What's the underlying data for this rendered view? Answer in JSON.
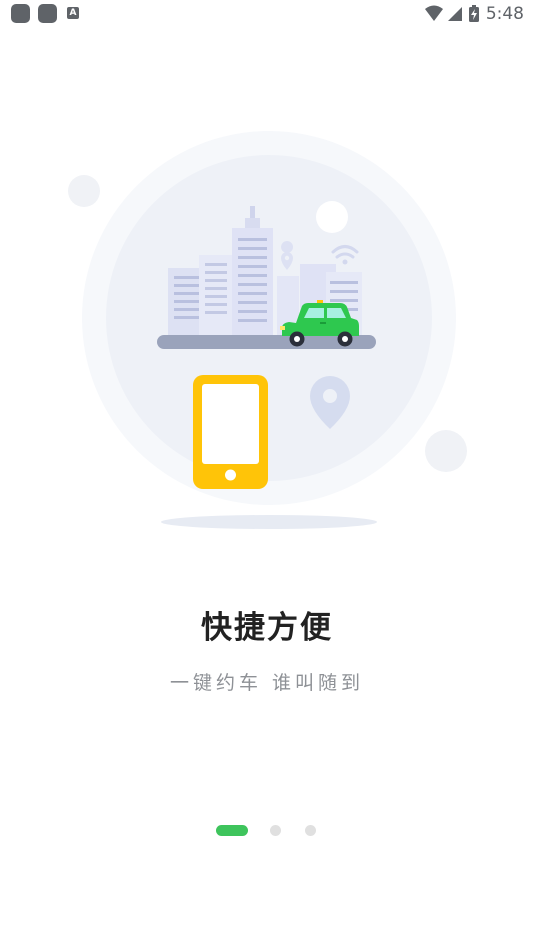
{
  "status_bar": {
    "time": "5:48",
    "left_icons": [
      "notification-square-icon",
      "notification-square-icon",
      "a-icon"
    ],
    "a_icon_text": "A",
    "right_icons": [
      "wifi-icon",
      "signal-icon",
      "battery-icon"
    ]
  },
  "onboarding": {
    "title": "快捷方便",
    "subtitle": "一键约车 谁叫随到",
    "page_indicator": {
      "current": 1,
      "total": 3,
      "active_color": "#3ec45c"
    }
  },
  "colors": {
    "phone_yellow": "#ffc408",
    "car_green": "#2ec84f",
    "building_lilac": "#dfe2f5",
    "road_gray": "#9aa3bb"
  }
}
